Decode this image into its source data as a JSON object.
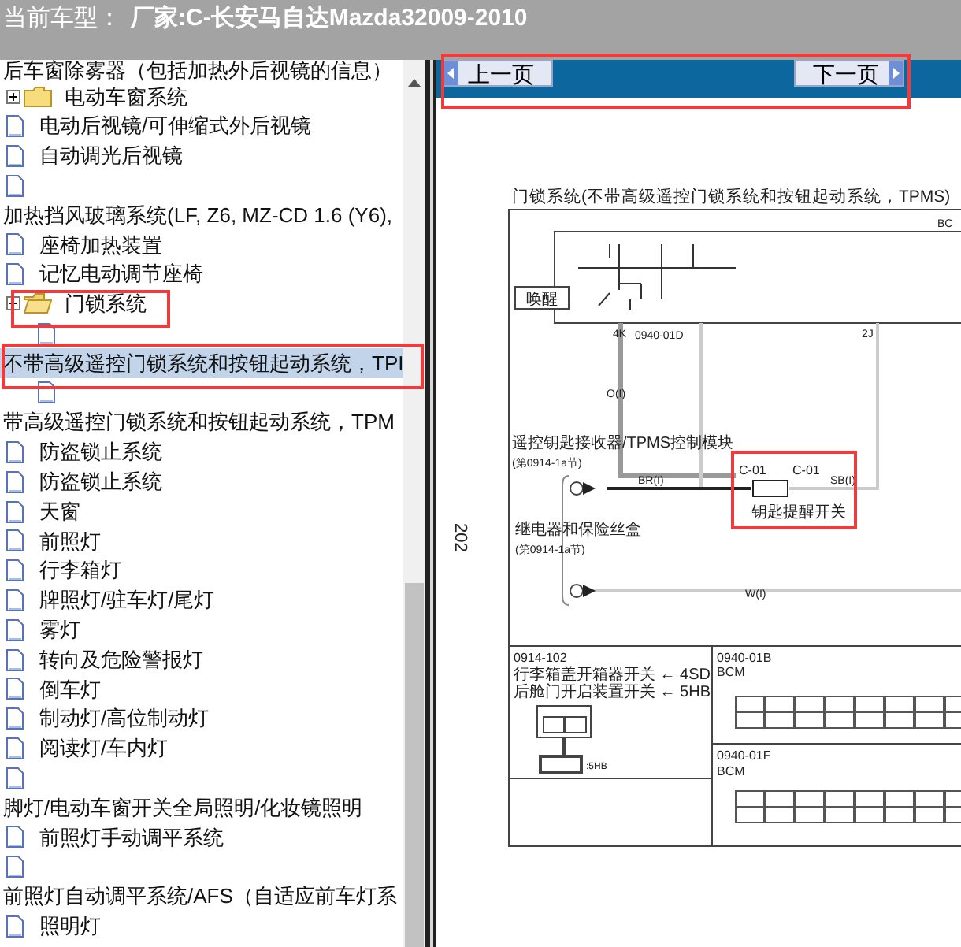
{
  "header": {
    "label": "当前车型：",
    "value": "厂家:C-长安马自达Mazda32009-2010"
  },
  "tree": {
    "items": [
      {
        "kind": "label",
        "label": "后车窗除雾器（包括加热外后视镜的信息）",
        "selected": false
      },
      {
        "kind": "folder",
        "label": "电动车窗系统",
        "expanded": false,
        "selected": false
      },
      {
        "kind": "page",
        "label": "电动后视镜/可伸缩式外后视镜",
        "selected": false
      },
      {
        "kind": "page",
        "label": "自动调光后视镜",
        "selected": false
      },
      {
        "kind": "page-wrapped",
        "label": "加热挡风玻璃系统(LF, Z6, MZ-CD 1.6 (Y6),",
        "selected": false
      },
      {
        "kind": "page",
        "label": "座椅加热装置",
        "selected": false
      },
      {
        "kind": "page",
        "label": "记忆电动调节座椅",
        "selected": false
      },
      {
        "kind": "folder",
        "label": "门锁系统",
        "expanded": true,
        "selected": false,
        "children": [
          {
            "kind": "page-wrapped",
            "label": "不带高级遥控门锁系统和按钮起动系统，TPI",
            "selected": true
          },
          {
            "kind": "page-wrapped",
            "label": "带高级遥控门锁系统和按钮起动系统，TPM",
            "selected": false
          }
        ]
      },
      {
        "kind": "page",
        "label": "防盗锁止系统",
        "selected": false
      },
      {
        "kind": "page",
        "label": "防盗锁止系统",
        "selected": false
      },
      {
        "kind": "page",
        "label": "天窗",
        "selected": false
      },
      {
        "kind": "page",
        "label": "前照灯",
        "selected": false
      },
      {
        "kind": "page",
        "label": "行李箱灯",
        "selected": false
      },
      {
        "kind": "page",
        "label": "牌照灯/驻车灯/尾灯",
        "selected": false
      },
      {
        "kind": "page",
        "label": "雾灯",
        "selected": false
      },
      {
        "kind": "page",
        "label": "转向及危险警报灯",
        "selected": false
      },
      {
        "kind": "page",
        "label": "倒车灯",
        "selected": false
      },
      {
        "kind": "page",
        "label": "制动灯/高位制动灯",
        "selected": false
      },
      {
        "kind": "page",
        "label": "阅读灯/车内灯",
        "selected": false
      },
      {
        "kind": "page-wrapped",
        "label": "脚灯/电动车窗开关全局照明/化妆镜照明",
        "selected": false
      },
      {
        "kind": "page",
        "label": "前照灯手动调平系统",
        "selected": false
      },
      {
        "kind": "page-wrapped",
        "label": "前照灯自动调平系统/AFS（自适应前车灯系",
        "selected": false
      },
      {
        "kind": "page",
        "label": "照明灯",
        "selected": false
      }
    ]
  },
  "nav": {
    "prev": "上一页",
    "next": "下一页"
  },
  "document": {
    "page_number": "202",
    "title": "门锁系统(不带高级遥控门锁系统和按钮起动系统，TPMS)",
    "module": "BC",
    "wake": "唤醒",
    "pin_4k": "4K",
    "pin_2j": "2J",
    "connector_01d": "0940-01D",
    "wire_o": "O(I)",
    "receiver": "遥控钥匙接收器/TPMS控制模块",
    "receiver_ref": "(第0914-1a节)",
    "wire_br": "BR(I)",
    "switch_left": "C-01",
    "switch_right": "C-01",
    "switch_name": "钥匙提醒开关",
    "wire_sb": "SB(I)",
    "relay_box": "继电器和保险丝盒",
    "relay_ref": "(第0914-1a节)",
    "wire_w": "W(I)",
    "box_1_code": "0914-102",
    "box_1_line_1": "行李箱盖开箱器开关 ← 4SD",
    "box_1_line_2": "后舱门开启装置开关 ← 5HB",
    "box_1_pin": ":5HB",
    "box_2_code": "0940-01B",
    "box_2_name": "BCM",
    "box_3_code": "0940-01F",
    "box_3_name": "BCM"
  }
}
